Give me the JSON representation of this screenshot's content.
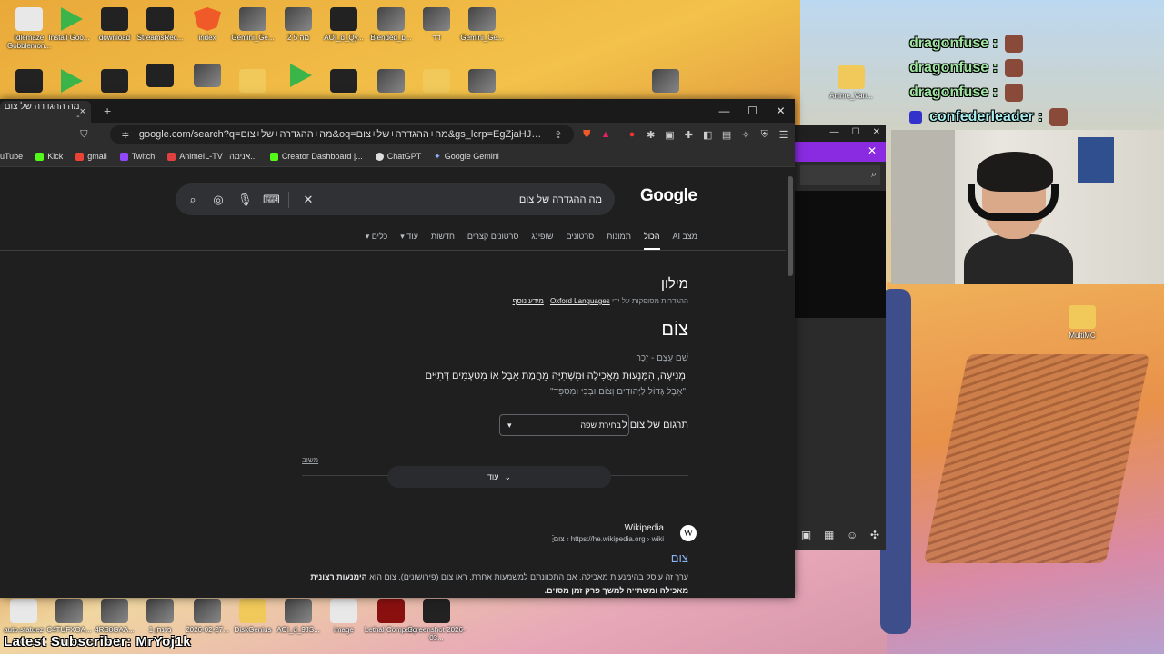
{
  "desktop": {
    "icons_row1": [
      "Idlemaze Gobblemon...",
      "Install Goo...",
      "download",
      "StreamsRec...",
      "index",
      "Gemini_Ge...",
      "2 מה 5",
      "AOI_d_Qy...",
      "Blended_b...",
      "דד",
      "Gemini_Ge..."
    ],
    "icons_row2": [
      "Anime_Van..."
    ],
    "icons_bottom": [
      "auto.statuez",
      "C4TUFXOA...",
      "4RS8GAA...",
      "מינחן 1",
      "2026-02-27...",
      "DiskGenius",
      "AOI_d_9JS...",
      "image",
      "Lethal Company",
      "Screenshot 2026-03..."
    ],
    "right_icon": "MultiMC",
    "latest_subscriber": "Latest Subscriber: MrYoj1k"
  },
  "chat": [
    {
      "user": "dragonfuse :",
      "color": "#9fe3a0"
    },
    {
      "user": "dragonfuse :",
      "color": "#9fe3a0"
    },
    {
      "user": "dragonfuse :",
      "color": "#9fe3a0"
    },
    {
      "user": "confederleader :",
      "color": "#a8f0f0"
    }
  ],
  "browser": {
    "tab_title": "מה ההגדרה של צום -",
    "tab_close": "×",
    "new_tab": "+",
    "window_controls": [
      "—",
      "☐",
      "✕"
    ],
    "url": "google.com/search?q=מה+ההגדרה+של+צום&oq=מה+ההגדרה+של+צום&gs_lcrp=EgZjaHJvbWUyBgg...",
    "bookmarks": [
      {
        "label": "uTube",
        "color": "#ff0000"
      },
      {
        "label": "Kick",
        "color": "#53fc18"
      },
      {
        "label": "gmail",
        "color": "#ea4335"
      },
      {
        "label": "Twitch",
        "color": "#9146ff"
      },
      {
        "label": "AnimeIL-TV | אנימה...",
        "color": "#e04040"
      },
      {
        "label": "Creator Dashboard |...",
        "color": "#53fc18"
      },
      {
        "label": "ChatGPT",
        "color": "#ffffff"
      },
      {
        "label": "Google Gemini",
        "color": "#8ab4f8"
      }
    ]
  },
  "google": {
    "logo": "Google",
    "query": "מה ההגדרה של צום",
    "nav": [
      {
        "label": "מצב AI",
        "active": false
      },
      {
        "label": "הכול",
        "active": true
      },
      {
        "label": "תמונות",
        "active": false
      },
      {
        "label": "סרטונים",
        "active": false
      },
      {
        "label": "שופינג",
        "active": false
      },
      {
        "label": "סרטונים קצרים",
        "active": false
      },
      {
        "label": "חדשות",
        "active": false
      },
      {
        "label": "עוד ▾",
        "active": false
      },
      {
        "label": "כלים ▾",
        "active": false
      }
    ],
    "dictionary": {
      "title": "מילון",
      "source_prefix": "ההגדרות מסופקות על ידי ",
      "source_link": "Oxford Languages",
      "source_sep": " · ",
      "more_info": "מידע נוסף",
      "word": "צוֹם",
      "pos": "שֵׁם עֶצֶם - זָכָר",
      "definition": "מְנִיעָה, הִמָּנְעוּת מֵאֲכִילָה וּמִשְׁתִיָּה מֵחֲמַת אֵבֶל אוֹ מִטְּעָמִים דָּתִיִּים",
      "example": "\"אֵבֶל גָּדוֹל לַיְּהוּדִים וְצוֹם וּבְכִי וּמִסְפֵּד\"",
      "translate_label": "תרגום של צום ל",
      "language_select": "בחירת שפה",
      "feedback": "משוב",
      "more": "עוד"
    },
    "result": {
      "site": "Wikipedia",
      "url": "https://he.wikipedia.org › wiki › צום",
      "title": "צום",
      "snippet_plain": "ערך זה עוסק בהימנעות מאכילה. אם התכוונתם למשמעות אחרת, ראו צום (פירושונים). צום הוא ",
      "snippet_bold": "הימנעות רצונית מאכילה ומשתייה למשך פרק זמן מסוים."
    }
  },
  "side_window": {
    "close": "✕"
  }
}
